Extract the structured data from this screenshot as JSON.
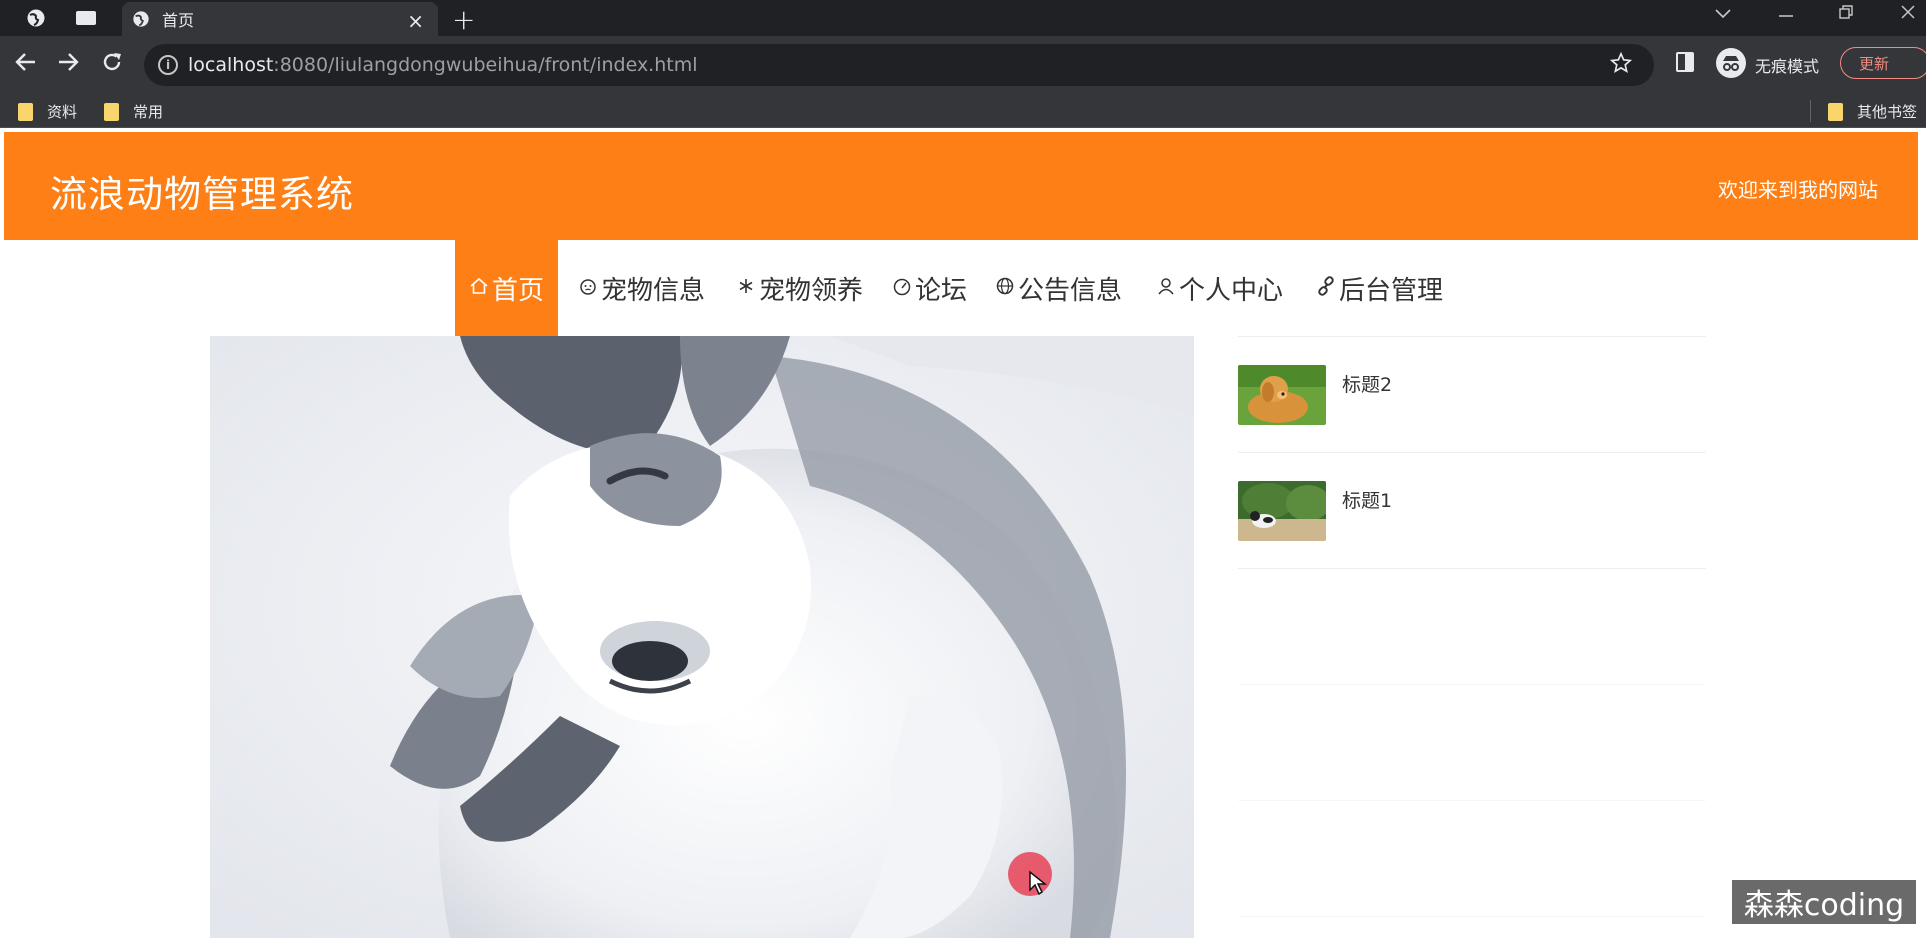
{
  "browser": {
    "tab_title": "首页",
    "tab_close_glyph": "×",
    "new_tab_glyph": "+",
    "url_host": "localhost",
    "url_rest": ":8080/liulangdongwubeihua/front/index.html",
    "incognito_label": "无痕模式",
    "update_label": "更新",
    "bookmarks": [
      {
        "label": "资料",
        "icon": "folder-icon"
      },
      {
        "label": "常用",
        "icon": "folder-icon"
      },
      {
        "label": "其他书签",
        "icon": "folder-icon"
      }
    ],
    "colors": {
      "frame": "#202124",
      "toolbar": "#35363a",
      "text": "#e8eaed"
    }
  },
  "site": {
    "title": "流浪动物管理系统",
    "welcome": "欢迎来到我的网站",
    "accent_color": "#fd7f16"
  },
  "nav": {
    "items": [
      {
        "label": "首页",
        "icon": "home-icon",
        "active": true
      },
      {
        "label": "宠物信息",
        "icon": "pet-face-icon",
        "active": false
      },
      {
        "label": "宠物领养",
        "icon": "snowflake-icon",
        "active": false
      },
      {
        "label": "论坛",
        "icon": "gauge-icon",
        "active": false
      },
      {
        "label": "公告信息",
        "icon": "globe-icon",
        "active": false
      },
      {
        "label": "个人中心",
        "icon": "user-icon",
        "active": false
      },
      {
        "label": "后台管理",
        "icon": "link-icon",
        "active": false
      }
    ]
  },
  "sidebar": {
    "items": [
      {
        "title": "标题2",
        "image": "golden-dog-thumbnail"
      },
      {
        "title": "标题1",
        "image": "dog-garden-thumbnail"
      }
    ]
  },
  "watermark": "森森coding"
}
